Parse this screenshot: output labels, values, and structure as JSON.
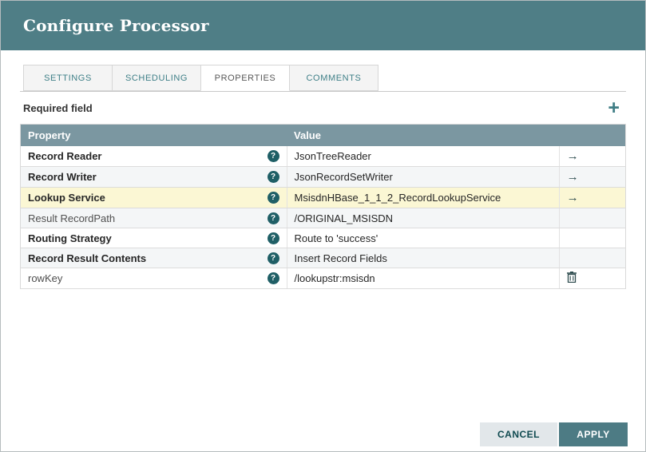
{
  "dialog": {
    "title": "Configure Processor"
  },
  "tabs": [
    {
      "label": "SETTINGS"
    },
    {
      "label": "SCHEDULING"
    },
    {
      "label": "PROPERTIES",
      "active": true
    },
    {
      "label": "COMMENTS"
    }
  ],
  "toolbar": {
    "required_field_label": "Required field",
    "add_icon": "+"
  },
  "icons": {
    "help": "?",
    "go_to": "→",
    "add": "+"
  },
  "table": {
    "columns": [
      "Property",
      "Value"
    ],
    "rows": [
      {
        "property": "Record Reader",
        "value": "JsonTreeReader",
        "required": true,
        "action": "go-to"
      },
      {
        "property": "Record Writer",
        "value": "JsonRecordSetWriter",
        "required": true,
        "action": "go-to"
      },
      {
        "property": "Lookup Service",
        "value": "MsisdnHBase_1_1_2_RecordLookupService",
        "required": true,
        "action": "go-to",
        "highlighted": true
      },
      {
        "property": "Result RecordPath",
        "value": "/ORIGINAL_MSISDN",
        "required": false,
        "action": "none"
      },
      {
        "property": "Routing Strategy",
        "value": "Route to 'success'",
        "required": true,
        "action": "none"
      },
      {
        "property": "Record Result Contents",
        "value": "Insert Record Fields",
        "required": true,
        "action": "none"
      },
      {
        "property": "rowKey",
        "value": "/lookupstr:msisdn",
        "required": false,
        "action": "delete"
      }
    ]
  },
  "footer": {
    "cancel_label": "CANCEL",
    "apply_label": "APPLY"
  },
  "colors": {
    "header_background": "#4f7e86",
    "table_header_background": "#7b97a1",
    "highlight_row": "#fbf7d4",
    "accent_teal": "#3e7f87",
    "apply_button": "#4d7b84"
  }
}
